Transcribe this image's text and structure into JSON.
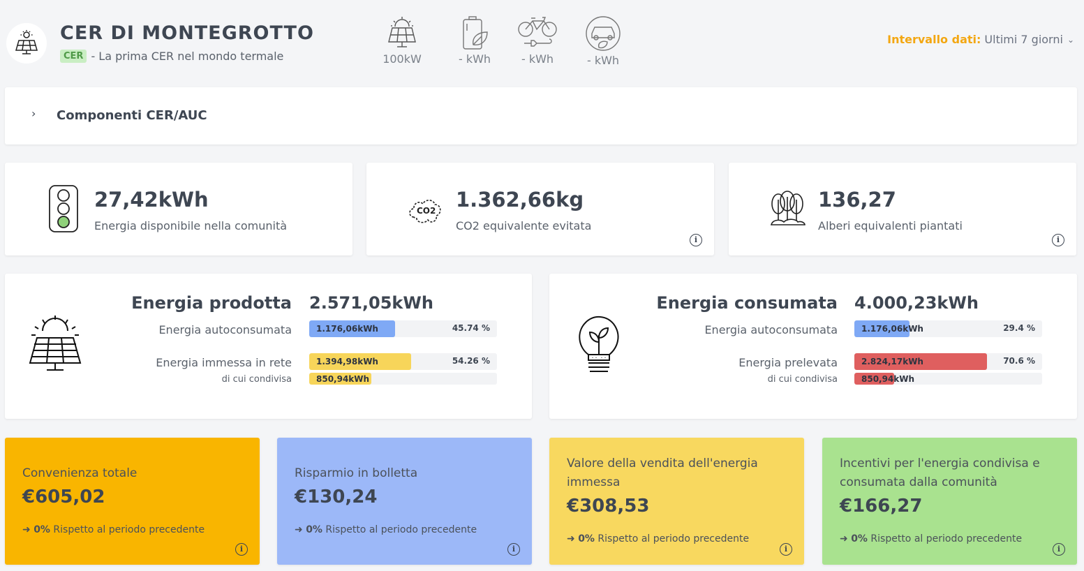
{
  "header": {
    "title": "CER DI MONTEGROTTO",
    "badge": "CER",
    "subtitle": "- La prima CER nel mondo termale",
    "stats": [
      {
        "icon": "solar-panel-icon",
        "label": "100kW"
      },
      {
        "icon": "battery-leaf-icon",
        "label": "- kWh"
      },
      {
        "icon": "bicycle-plug-icon",
        "label": "- kWh"
      },
      {
        "icon": "eco-car-icon",
        "label": "- kWh"
      }
    ],
    "interval_label": "Intervallo dati:",
    "interval_value": "Ultimi 7 giorni"
  },
  "components": {
    "title": "Componenti CER/AUC"
  },
  "kpis": [
    {
      "icon": "traffic-light-icon",
      "value": "27,42kWh",
      "desc": "Energia disponibile nella comunità"
    },
    {
      "icon": "co2-cloud-icon",
      "value": "1.362,66kg",
      "desc": "CO2 equivalente evitata"
    },
    {
      "icon": "trees-icon",
      "value": "136,27",
      "desc": "Alberi equivalenti piantati"
    }
  ],
  "produced": {
    "title": "Energia prodotta",
    "total": "2.571,05kWh",
    "rows": [
      {
        "label": "Energia autoconsumata",
        "bar_text": "1.176,06kWh",
        "pct_text": "45.74 %",
        "fraction": 0.4574,
        "color": "#7fa9f5"
      },
      {
        "label": "Energia immessa in rete",
        "bar_text": "1.394,98kWh",
        "pct_text": "54.26 %",
        "fraction": 0.5426,
        "color": "#f7d55a"
      }
    ],
    "shared": {
      "label": "di cui condivisa",
      "bar_text": "850,94kWh",
      "fraction": 0.331,
      "color": "#f7d55a"
    }
  },
  "consumed": {
    "title": "Energia consumata",
    "total": "4.000,23kWh",
    "rows": [
      {
        "label": "Energia autoconsumata",
        "bar_text": "1.176,06kWh",
        "pct_text": "29.4 %",
        "fraction": 0.294,
        "color": "#7fa9f5"
      },
      {
        "label": "Energia prelevata",
        "bar_text": "2.824,17kWh",
        "pct_text": "70.6 %",
        "fraction": 0.706,
        "color": "#df5f5f"
      }
    ],
    "shared": {
      "label": "di cui condivisa",
      "bar_text": "850,94kWh",
      "fraction": 0.213,
      "color": "#df5f5f"
    }
  },
  "money": [
    {
      "label": "Convenienza totale",
      "amount": "€605,02",
      "change": "0%",
      "compare": "Rispetto al periodo precedente",
      "color": "#f9b500"
    },
    {
      "label": "Risparmio in bolletta",
      "amount": "€130,24",
      "change": "0%",
      "compare": "Rispetto al periodo precedente",
      "color": "#9cb8f8"
    },
    {
      "label": "Valore della vendita dell'energia immessa",
      "amount": "€308,53",
      "change": "0%",
      "compare": "Rispetto al periodo precedente",
      "color": "#f8d85f"
    },
    {
      "label": "Incentivi per l'energia condivisa e consumata dalla comunità",
      "amount": "€166,27",
      "change": "0%",
      "compare": "Rispetto al periodo precedente",
      "color": "#a9e28f"
    }
  ],
  "info_glyph": "i",
  "arrow_glyph": "➜"
}
